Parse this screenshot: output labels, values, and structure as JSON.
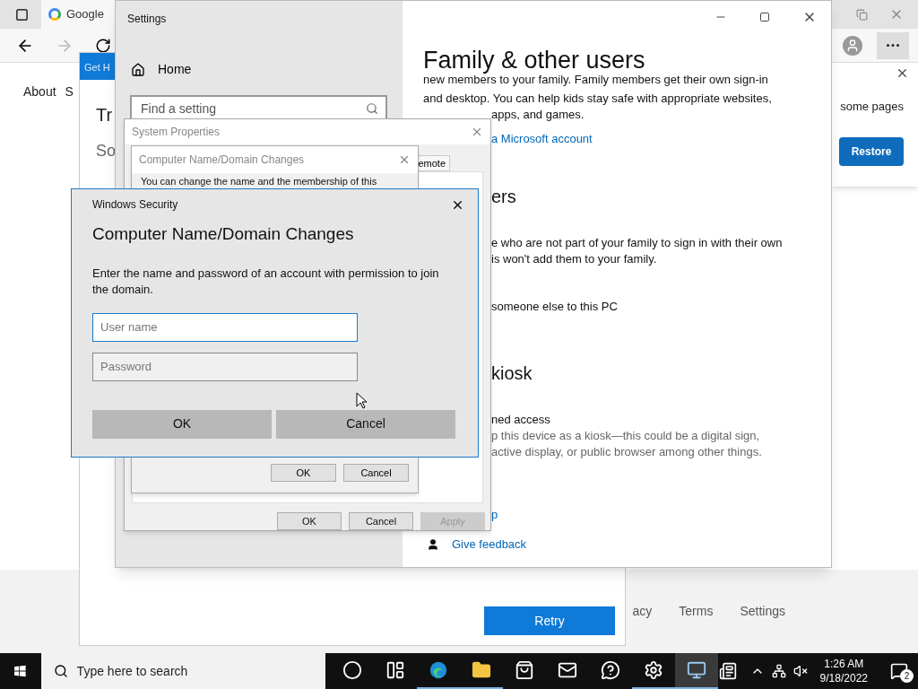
{
  "browser": {
    "tab_title": "Google",
    "nav_links": [
      "About",
      "S"
    ],
    "restore_popup": {
      "message": "some pages",
      "button": "Restore"
    },
    "footer_links": [
      "acy",
      "Terms",
      "Settings"
    ]
  },
  "error_page": {
    "banner": "Get H",
    "heading": "Tr",
    "subheading": "So",
    "button": "Retry"
  },
  "settings": {
    "title": "Settings",
    "home": "Home",
    "search": {
      "placeholder": "Find a setting"
    },
    "page_title": "Family & other users",
    "content_top": [
      {
        "kind": "text",
        "text": "new members to your family. Family members get their own sign-in"
      },
      {
        "kind": "text",
        "text": "and desktop. You can help kids stay safe with appropriate websites,"
      }
    ],
    "content_partial": [
      {
        "kind": "text",
        "text": "apps, and games."
      },
      {
        "kind": "link",
        "text": "a Microsoft account"
      },
      {
        "kind": "heading",
        "text": "ers"
      },
      {
        "kind": "text",
        "text": "e who are not part of your family to sign in with their own"
      },
      {
        "kind": "text",
        "text": "is won't add them to your family."
      },
      {
        "kind": "action",
        "text": "someone else to this PC"
      },
      {
        "kind": "heading",
        "text": "kiosk"
      },
      {
        "kind": "text",
        "text": "ned access"
      },
      {
        "kind": "muted",
        "text": "p this device as a kiosk—this could be a digital sign,"
      },
      {
        "kind": "muted",
        "text": "active display, or public browser among other things."
      },
      {
        "kind": "support_link",
        "text": "p"
      }
    ],
    "feedback_link": "Give feedback"
  },
  "system_properties": {
    "title": "System Properties",
    "tab": "emote",
    "buttons": [
      {
        "label": "OK",
        "disabled": false
      },
      {
        "label": "Cancel",
        "disabled": false
      },
      {
        "label": "Apply",
        "disabled": true
      }
    ]
  },
  "domain_changes": {
    "title": "Computer Name/Domain Changes",
    "text": "You can change the name and the membership of this",
    "buttons": [
      "OK",
      "Cancel"
    ]
  },
  "security": {
    "window_title": "Windows Security",
    "heading": "Computer Name/Domain Changes",
    "message": "Enter the name and password of an account with permission to join the domain.",
    "fields": [
      {
        "placeholder": "User name",
        "focused": true
      },
      {
        "placeholder": "Password",
        "focused": false
      }
    ],
    "buttons": [
      "OK",
      "Cancel"
    ]
  },
  "taskbar": {
    "search": {
      "placeholder": "Type here to search"
    },
    "apps": [
      {
        "kind": "cortana",
        "running": false,
        "selected": false
      },
      {
        "kind": "taskview",
        "running": false,
        "selected": false
      },
      {
        "kind": "edge",
        "running": true,
        "selected": false
      },
      {
        "kind": "explorer",
        "running": true,
        "selected": false
      },
      {
        "kind": "store",
        "running": false,
        "selected": false
      },
      {
        "kind": "mail",
        "running": false,
        "selected": false
      },
      {
        "kind": "feedback",
        "running": false,
        "selected": false
      },
      {
        "kind": "settings",
        "running": true,
        "selected": false
      },
      {
        "kind": "system",
        "running": true,
        "selected": true
      }
    ],
    "time": "1:26 AM",
    "date": "9/18/2022",
    "notifications": "2"
  }
}
